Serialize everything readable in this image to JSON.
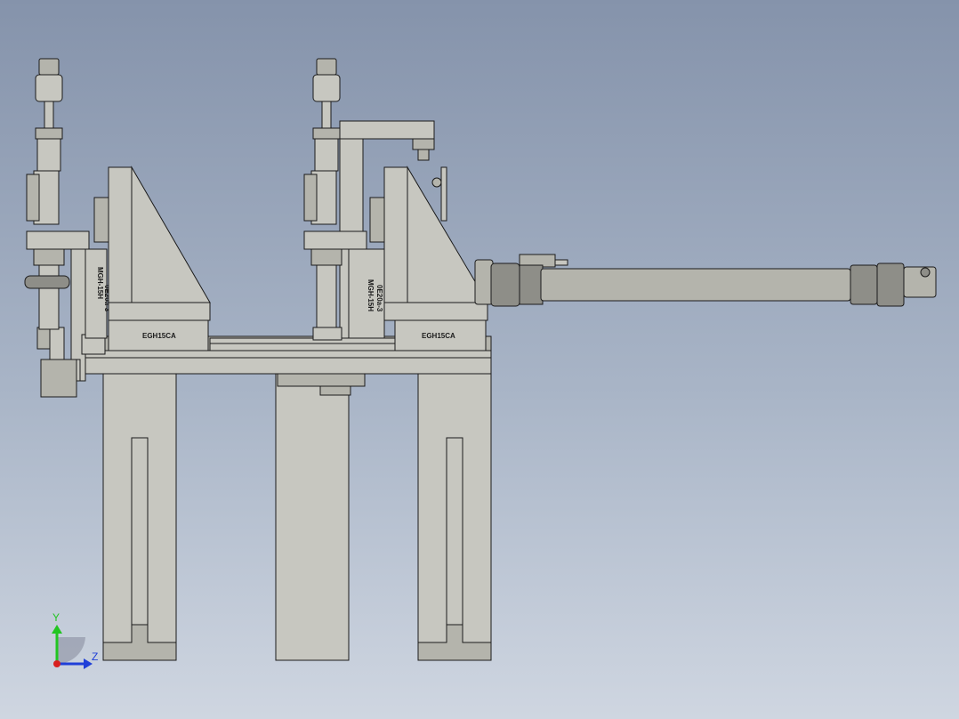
{
  "part_labels": {
    "gripper_left": "EGH15CA",
    "gripper_right": "EGH15CA",
    "slide_left_a": "MGH-15H",
    "slide_left_b": "0E20a-3",
    "slide_right_a": "MGH-15H",
    "slide_right_b": "0E20a-3"
  },
  "triad": {
    "y_axis": "Y",
    "z_axis": "Z",
    "y_color": "#22c522",
    "z_color": "#1f3fd8",
    "x_color": "#d81f1f"
  },
  "colors": {
    "part_light": "#c7c7c0",
    "part_mid": "#b4b4ac",
    "part_dark": "#8e8e88",
    "edge": "#1b1b1b"
  }
}
